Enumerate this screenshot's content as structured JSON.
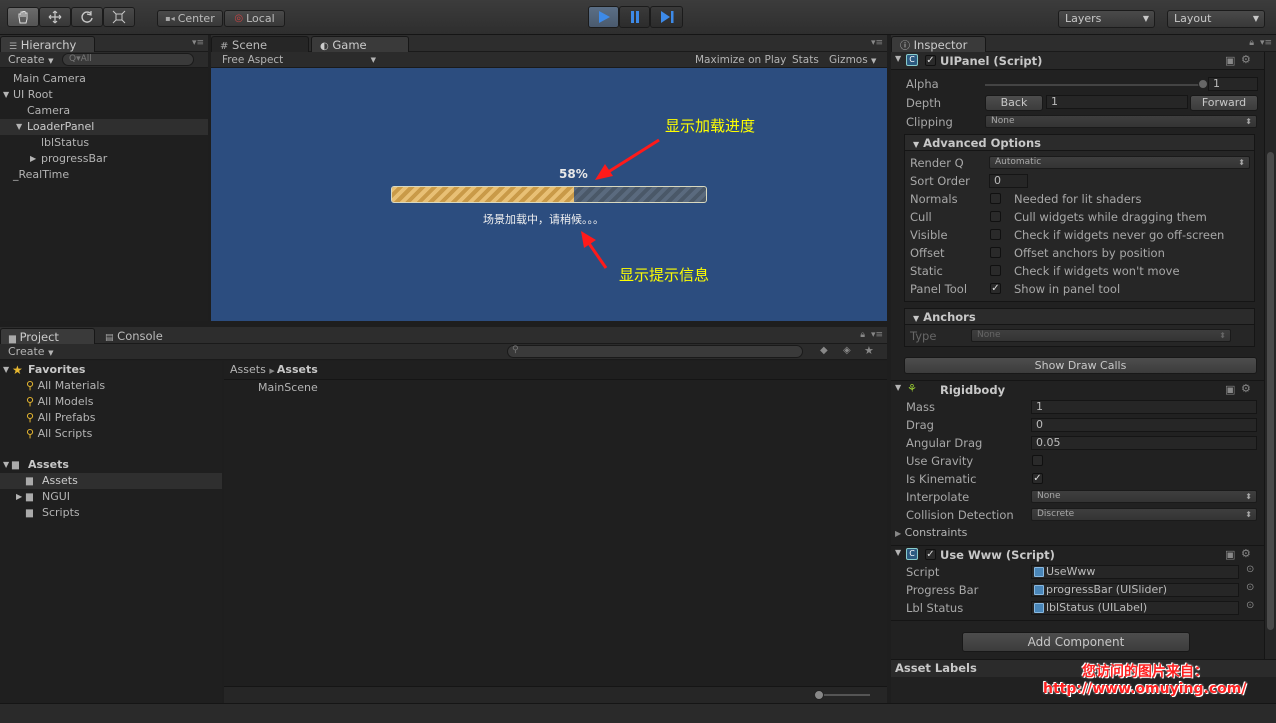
{
  "toolbar": {
    "tools": [
      "hand-icon",
      "move-icon",
      "rotate-icon",
      "scale-icon"
    ],
    "center_label": "Center",
    "local_label": "Local",
    "layers_label": "Layers",
    "layout_label": "Layout"
  },
  "hierarchy": {
    "tab": "Hierarchy",
    "create": "Create",
    "search_placeholder": "Q▾All",
    "items": [
      "Main Camera",
      "UI Root",
      "Camera",
      "LoaderPanel",
      "lblStatus",
      "progressBar",
      "_RealTime"
    ]
  },
  "scene_tab": "Scene",
  "game": {
    "tab": "Game",
    "aspect": "Free Aspect",
    "maximize": "Maximize on Play",
    "stats": "Stats",
    "gizmos": "Gizmos",
    "percent": "58%",
    "progress": 0.58,
    "status_text": "场景加载中，请稍候。。。",
    "annotation_progress": "显示加载进度",
    "annotation_info": "显示提示信息"
  },
  "project": {
    "tab": "Project",
    "console_tab": "Console",
    "create": "Create",
    "favorites": "Favorites",
    "fav_items": [
      "All Materials",
      "All Models",
      "All Prefabs",
      "All Scripts"
    ],
    "assets": "Assets",
    "asset_items": [
      "Assets",
      "NGUI",
      "Scripts"
    ],
    "breadcrumb_root": "Assets",
    "breadcrumb_current": "Assets",
    "files": [
      "MainScene"
    ]
  },
  "inspector": {
    "tab": "Inspector",
    "uipanel": {
      "title": "UIPanel (Script)",
      "alpha_label": "Alpha",
      "alpha_value": "1",
      "alpha": 1,
      "depth_label": "Depth",
      "back": "Back",
      "depth_value": "1",
      "forward": "Forward",
      "clipping_label": "Clipping",
      "clipping_value": "None",
      "advanced": "Advanced Options",
      "renderq_label": "Render Q",
      "renderq_value": "Automatic",
      "sortorder_label": "Sort Order",
      "sortorder_value": "0",
      "options": [
        {
          "label": "Normals",
          "text": "Needed for lit shaders",
          "checked": false
        },
        {
          "label": "Cull",
          "text": "Cull widgets while dragging them",
          "checked": false
        },
        {
          "label": "Visible",
          "text": "Check if widgets never go off-screen",
          "checked": false
        },
        {
          "label": "Offset",
          "text": "Offset anchors by position",
          "checked": false
        },
        {
          "label": "Static",
          "text": "Check if widgets won't move",
          "checked": false
        },
        {
          "label": "Panel Tool",
          "text": "Show in panel tool",
          "checked": true
        }
      ],
      "anchors": "Anchors",
      "type_label": "Type",
      "type_value": "None",
      "show_draw_calls": "Show Draw Calls"
    },
    "rigidbody": {
      "title": "Rigidbody",
      "mass_label": "Mass",
      "mass": "1",
      "drag_label": "Drag",
      "drag": "0",
      "angular_label": "Angular Drag",
      "angular": "0.05",
      "gravity_label": "Use Gravity",
      "gravity": false,
      "kinematic_label": "Is Kinematic",
      "kinematic": true,
      "interpolate_label": "Interpolate",
      "interpolate": "None",
      "collision_label": "Collision Detection",
      "collision": "Discrete",
      "constraints_label": "Constraints"
    },
    "usewww": {
      "title": "Use Www (Script)",
      "script_label": "Script",
      "script": "UseWww",
      "progress_label": "Progress Bar",
      "progress": "progressBar (UISlider)",
      "status_label": "Lbl Status",
      "status": "lblStatus (UILabel)"
    },
    "add_component": "Add Component",
    "asset_labels": "Asset Labels"
  },
  "watermark": {
    "line1": "您访问的图片来自：",
    "line2": "http://www.omuying.com/"
  },
  "colors": {
    "accent": "#3d6fb0",
    "annotation": "#ffff00",
    "arrow": "#ff1a1a",
    "watermark": "#ff2020"
  }
}
